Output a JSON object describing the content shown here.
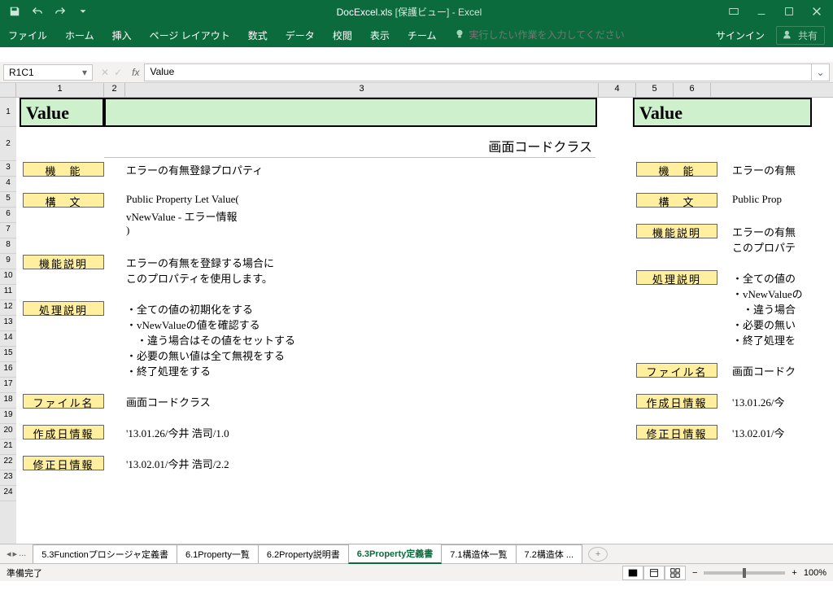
{
  "title": {
    "doc": "DocExcel.xls",
    "mode": "[保護ビュー]",
    "app": "- Excel"
  },
  "ribbon": {
    "tabs": [
      "ファイル",
      "ホーム",
      "挿入",
      "ページ レイアウト",
      "数式",
      "データ",
      "校閲",
      "表示",
      "チーム"
    ],
    "tellme": "実行したい作業を入力してください",
    "signin": "サインイン",
    "share": "共有"
  },
  "fx": {
    "ref": "R1C1",
    "value": "Value"
  },
  "cols": [
    "1",
    "2",
    "3",
    "4",
    "5",
    "6"
  ],
  "rows": [
    "1",
    "2",
    "3",
    "4",
    "5",
    "6",
    "7",
    "8",
    "9",
    "10",
    "11",
    "12",
    "13",
    "14",
    "15",
    "16",
    "17",
    "18",
    "19",
    "20",
    "21",
    "22",
    "23",
    "24"
  ],
  "doc": {
    "header": "Value",
    "class_title": "画面コードクラス",
    "labels": {
      "func": "機　能",
      "syntax": "構　文",
      "func_desc": "機能説明",
      "proc_desc": "処理説明",
      "file": "ファイル名",
      "created": "作成日情報",
      "modified": "修正日情報"
    },
    "func": "エラーの有無登録プロパティ",
    "syntax": [
      "Public Property Let Value(",
      "  vNewValue  - エラー情報",
      ")"
    ],
    "func_desc": [
      "エラーの有無を登録する場合に",
      "このプロパティを使用します。"
    ],
    "proc_desc": [
      "・全ての値の初期化をする",
      "・vNewValueの値を確認する",
      "　・違う場合はその値をセットする",
      "・必要の無い値は全て無視をする",
      "・終了処理をする"
    ],
    "file": "画面コードクラス",
    "created": "'13.01.26/今井 浩司/1.0",
    "modified": "'13.02.01/今井 浩司/2.2",
    "r_func": "エラーの有無",
    "r_syntax": "Public Prop",
    "r_fd1": "エラーの有無",
    "r_fd2": "このプロパテ",
    "r_pd": [
      "・全ての値の",
      "・vNewValueの",
      "　・違う場合",
      "・必要の無い",
      "・終了処理を"
    ],
    "r_file": "画面コードク",
    "r_created": "'13.01.26/今",
    "r_modified": "'13.02.01/今"
  },
  "sheets": {
    "tabs": [
      "5.3Functionプロシージャ定義書",
      "6.1Property一覧",
      "6.2Property説明書",
      "6.3Property定義書",
      "7.1構造体一覧",
      "7.2構造体 ..."
    ],
    "active": 3
  },
  "status": {
    "ready": "準備完了",
    "zoom": "100%"
  }
}
